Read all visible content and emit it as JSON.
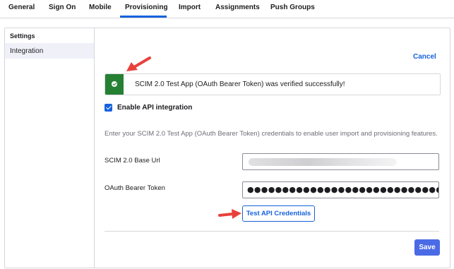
{
  "tabs": [
    {
      "label": "General"
    },
    {
      "label": "Sign On"
    },
    {
      "label": "Mobile"
    },
    {
      "label": "Provisioning",
      "active": true
    },
    {
      "label": "Import"
    },
    {
      "label": "Assignments"
    },
    {
      "label": "Push Groups"
    }
  ],
  "sidebar": {
    "heading": "Settings",
    "items": [
      {
        "label": "Integration",
        "selected": true
      }
    ]
  },
  "cancel_label": "Cancel",
  "banner": {
    "message": "SCIM 2.0 Test App (OAuth Bearer Token) was verified successfully!",
    "status": "success",
    "color": "#258033"
  },
  "enable_api": {
    "label": "Enable API integration",
    "checked": true
  },
  "description": "Enter your SCIM 2.0 Test App (OAuth Bearer Token) credentials to enable user import and provisioning features.",
  "fields": {
    "base_url": {
      "label": "SCIM 2.0 Base Url",
      "value": ""
    },
    "token": {
      "label": "OAuth Bearer Token",
      "value": "●●●●●●●●●●●●●●●●●●●●●●●●●●●●●●●●●"
    }
  },
  "test_button_label": "Test API Credentials",
  "save_label": "Save",
  "colors": {
    "accent": "#1662dd",
    "save": "#4b6ae6",
    "success": "#258033",
    "annotation_arrow": "#e8413c"
  }
}
